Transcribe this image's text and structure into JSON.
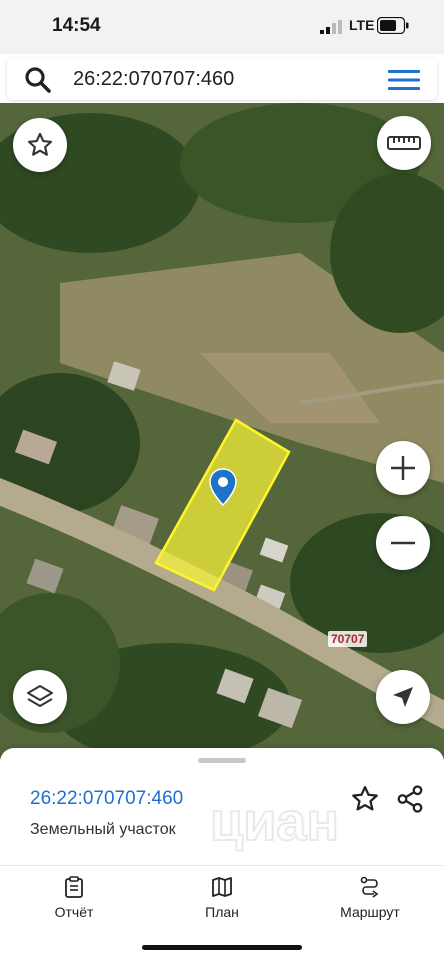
{
  "status": {
    "time": "14:54",
    "network": "LTE"
  },
  "search": {
    "query": "26:22:070707:460",
    "icon": "search-icon",
    "menu_icon": "menu-icon"
  },
  "map": {
    "label_block": "70707",
    "buttons": {
      "favorite_icon": "star-icon",
      "ruler_icon": "ruler-icon",
      "zoom_in_icon": "plus-icon",
      "zoom_out_icon": "minus-icon",
      "layers_icon": "layers-icon",
      "locate_icon": "navigation-arrow-icon"
    },
    "parcel_color": "#f4f03a",
    "pin_color": "#1e73c8"
  },
  "sheet": {
    "cadastral_number": "26:22:070707:460",
    "object_type": "Земельный участок",
    "watermark": "циан",
    "accent": "#1e6fd0"
  },
  "tabs": [
    {
      "label": "Отчёт",
      "icon": "report-icon"
    },
    {
      "label": "План",
      "icon": "map-plan-icon"
    },
    {
      "label": "Маршрут",
      "icon": "route-icon"
    }
  ]
}
